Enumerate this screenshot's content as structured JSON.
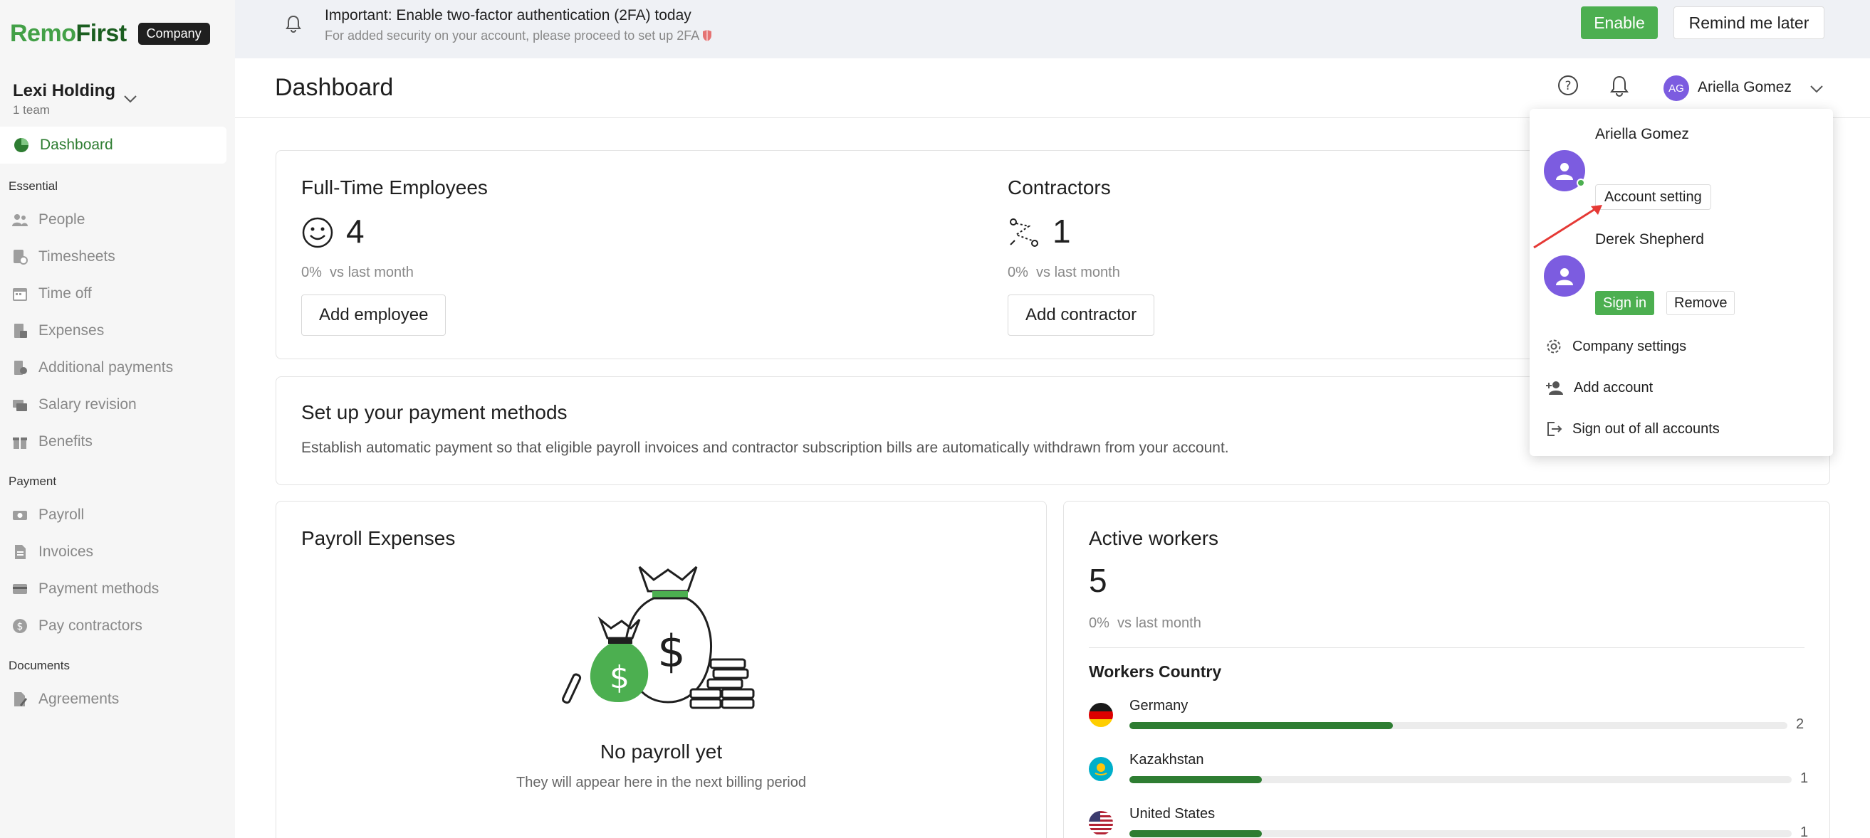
{
  "brand": {
    "name_part1": "Remo",
    "name_part2": "First",
    "badge": "Company"
  },
  "company": {
    "name": "Lexi Holding",
    "sub": "1 team"
  },
  "sidebar": {
    "active": {
      "label": "Dashboard",
      "icon": "pie-chart-icon"
    },
    "sections": [
      {
        "title": "Essential",
        "items": [
          {
            "label": "People",
            "icon": "people-icon"
          },
          {
            "label": "Timesheets",
            "icon": "timesheet-icon"
          },
          {
            "label": "Time off",
            "icon": "calendar-icon"
          },
          {
            "label": "Expenses",
            "icon": "expenses-icon"
          },
          {
            "label": "Additional payments",
            "icon": "additional-payments-icon"
          },
          {
            "label": "Salary revision",
            "icon": "salary-revision-icon"
          },
          {
            "label": "Benefits",
            "icon": "gift-icon"
          }
        ]
      },
      {
        "title": "Payment",
        "items": [
          {
            "label": "Payroll",
            "icon": "payroll-icon"
          },
          {
            "label": "Invoices",
            "icon": "invoice-icon"
          },
          {
            "label": "Payment methods",
            "icon": "card-icon"
          },
          {
            "label": "Pay contractors",
            "icon": "dollar-coin-icon"
          }
        ]
      },
      {
        "title": "Documents",
        "items": [
          {
            "label": "Agreements",
            "icon": "agreement-icon"
          }
        ]
      }
    ]
  },
  "banner": {
    "title": "Important: Enable two-factor authentication (2FA) today",
    "subtitle": "For added security on your account, please proceed to set up 2FA",
    "enable": "Enable",
    "remind": "Remind me later"
  },
  "header": {
    "title": "Dashboard",
    "user_initials": "AG",
    "user_name": "Ariella Gomez"
  },
  "cards": {
    "fte": {
      "title": "Full-Time Employees",
      "value": "4",
      "change": "0%",
      "change_label": "vs last month",
      "button": "Add employee"
    },
    "contractors": {
      "title": "Contractors",
      "value": "1",
      "change": "0%",
      "change_label": "vs last month",
      "button": "Add contractor"
    },
    "payment_methods": {
      "title": "Set up your payment methods",
      "description": "Establish automatic payment so that eligible payroll invoices and contractor subscription bills are automatically withdrawn from your account."
    },
    "payroll": {
      "title": "Payroll Expenses",
      "empty_title": "No payroll yet",
      "empty_sub": "They will appear here in the next billing period"
    },
    "active_workers": {
      "title": "Active workers",
      "value": "5",
      "change": "0%",
      "change_label": "vs last month",
      "countries_title": "Workers Country",
      "countries": [
        {
          "name": "Germany",
          "count": "2",
          "share": 0.4
        },
        {
          "name": "Kazakhstan",
          "count": "1",
          "share": 0.2
        },
        {
          "name": "United States",
          "count": "1",
          "share": 0.2
        }
      ]
    }
  },
  "dropdown": {
    "accounts": [
      {
        "name": "Ariella Gomez",
        "action": "Account setting",
        "online": true
      },
      {
        "name": "Derek Shepherd",
        "signin": "Sign in",
        "remove": "Remove"
      }
    ],
    "menu": [
      {
        "label": "Company settings",
        "icon": "gear-icon"
      },
      {
        "label": "Add account",
        "icon": "add-person-icon"
      },
      {
        "label": "Sign out of all accounts",
        "icon": "sign-out-icon"
      }
    ]
  },
  "colors": {
    "brand_green": "#43a047",
    "dark_green": "#2e7d32",
    "avatar_purple": "#7c5ce0",
    "annotation_red": "#e53935"
  }
}
